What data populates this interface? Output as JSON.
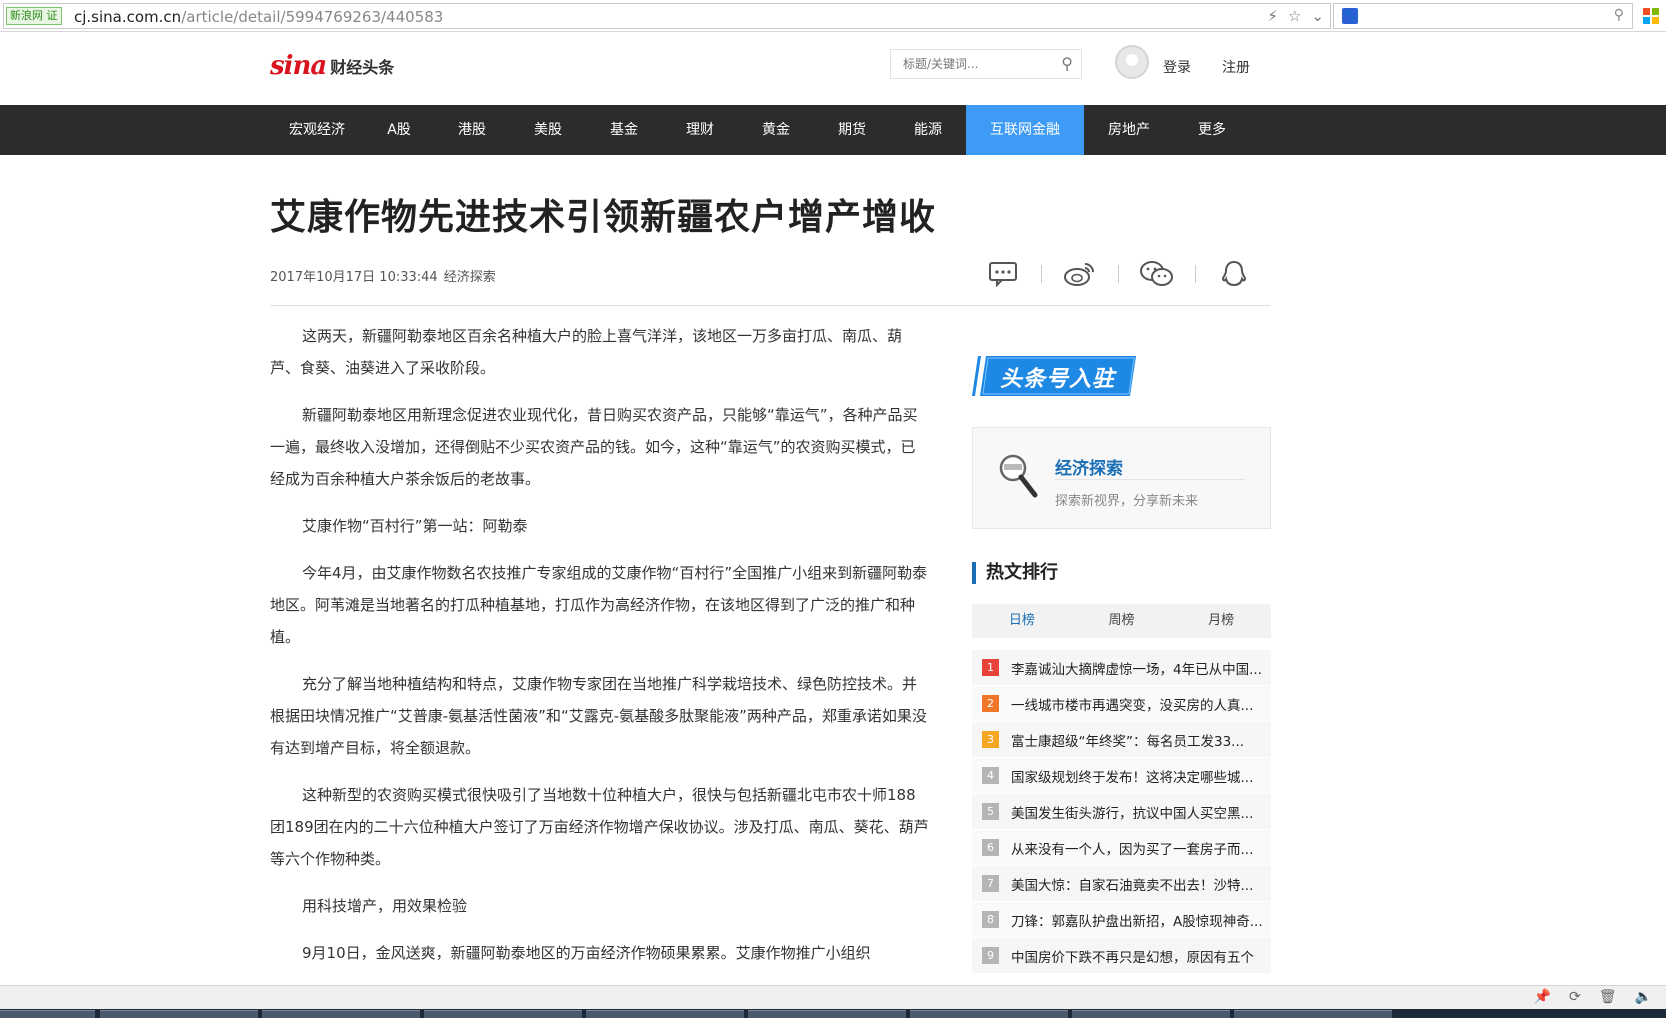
{
  "browser": {
    "cert_label": "新浪网 证",
    "url_host": "cj.sina.com.cn",
    "url_path": "/article/detail/5994769263/440583",
    "search_engine": "paw-icon"
  },
  "header": {
    "logo_mark": "sina",
    "logo_text": "财经头条",
    "search_placeholder": "标题/关键词...",
    "login": "登录",
    "register": "注册"
  },
  "nav": {
    "items": [
      "宏观经济",
      "A股",
      "港股",
      "美股",
      "基金",
      "理财",
      "黄金",
      "期货",
      "能源",
      "互联网金融",
      "房地产",
      "更多"
    ],
    "active": "互联网金融"
  },
  "article": {
    "title": "艾康作物先进技术引领新疆农户增产增收",
    "date": "2017年10月17日 10:33:44",
    "source": "经济探索",
    "paragraphs": [
      "这两天，新疆阿勒泰地区百余名种植大户的脸上喜气洋洋，该地区一万多亩打瓜、南瓜、葫芦、食葵、油葵进入了采收阶段。",
      "新疆阿勒泰地区用新理念促进农业现代化，昔日购买农资产品，只能够“靠运气”，各种产品买一遍，最终收入没增加，还得倒贴不少买农资产品的钱。如今，这种“靠运气”的农资购买模式，已经成为百余种植大户茶余饭后的老故事。",
      "艾康作物“百村行”第一站：阿勒泰",
      "今年4月，由艾康作物数名农技推广专家组成的艾康作物“百村行”全国推广小组来到新疆阿勒泰地区。阿苇滩是当地著名的打瓜种植基地，打瓜作为高经济作物，在该地区得到了广泛的推广和种植。",
      "充分了解当地种植结构和特点，艾康作物专家团在当地推广科学栽培技术、绿色防控技术。并根据田块情况推广“艾普康-氨基活性菌液”和“艾露克-氨基酸多肽聚能液”两种产品，郑重承诺如果没有达到增产目标，将全额退款。",
      "这种新型的农资购买模式很快吸引了当地数十位种植大户，很快与包括新疆北屯市农十师188团189团在内的二十六位种植大户签订了万亩经济作物增产保收协议。涉及打瓜、南瓜、葵花、葫芦等六个作物种类。",
      "用科技增产，用效果检验",
      "9月10日，金风送爽，新疆阿勒泰地区的万亩经济作物硕果累累。艾康作物推广小组织"
    ]
  },
  "sidebar": {
    "banner_text": "头条号入驻",
    "author": {
      "name": "经济探索",
      "desc": "探索新视界，分享新未来"
    },
    "hot": {
      "title": "热文排行",
      "tabs": [
        "日榜",
        "周榜",
        "月榜"
      ],
      "items": [
        "李嘉诚汕大摘牌虚惊一场，4年已从中国...",
        "一线城市楼市再遇突变，没买房的人真...",
        "富士康超级“年终奖”：每名员工发33...",
        "国家级规划终于发布！这将决定哪些城...",
        "美国发生街头游行，抗议中国人买空黑...",
        "从来没有一个人，因为买了一套房子而...",
        "美国大惊：自家石油竟卖不出去！沙特...",
        "刀锋：郭嘉队护盘出新招，A股惊现神奇...",
        "中国房价下跌不再只是幻想，原因有五个"
      ]
    }
  },
  "colors": {
    "nav_bg": "#2c2c2c",
    "nav_active": "#3d9bf5",
    "accent_blue": "#1a6fb5",
    "sina_red": "#d9141f"
  }
}
